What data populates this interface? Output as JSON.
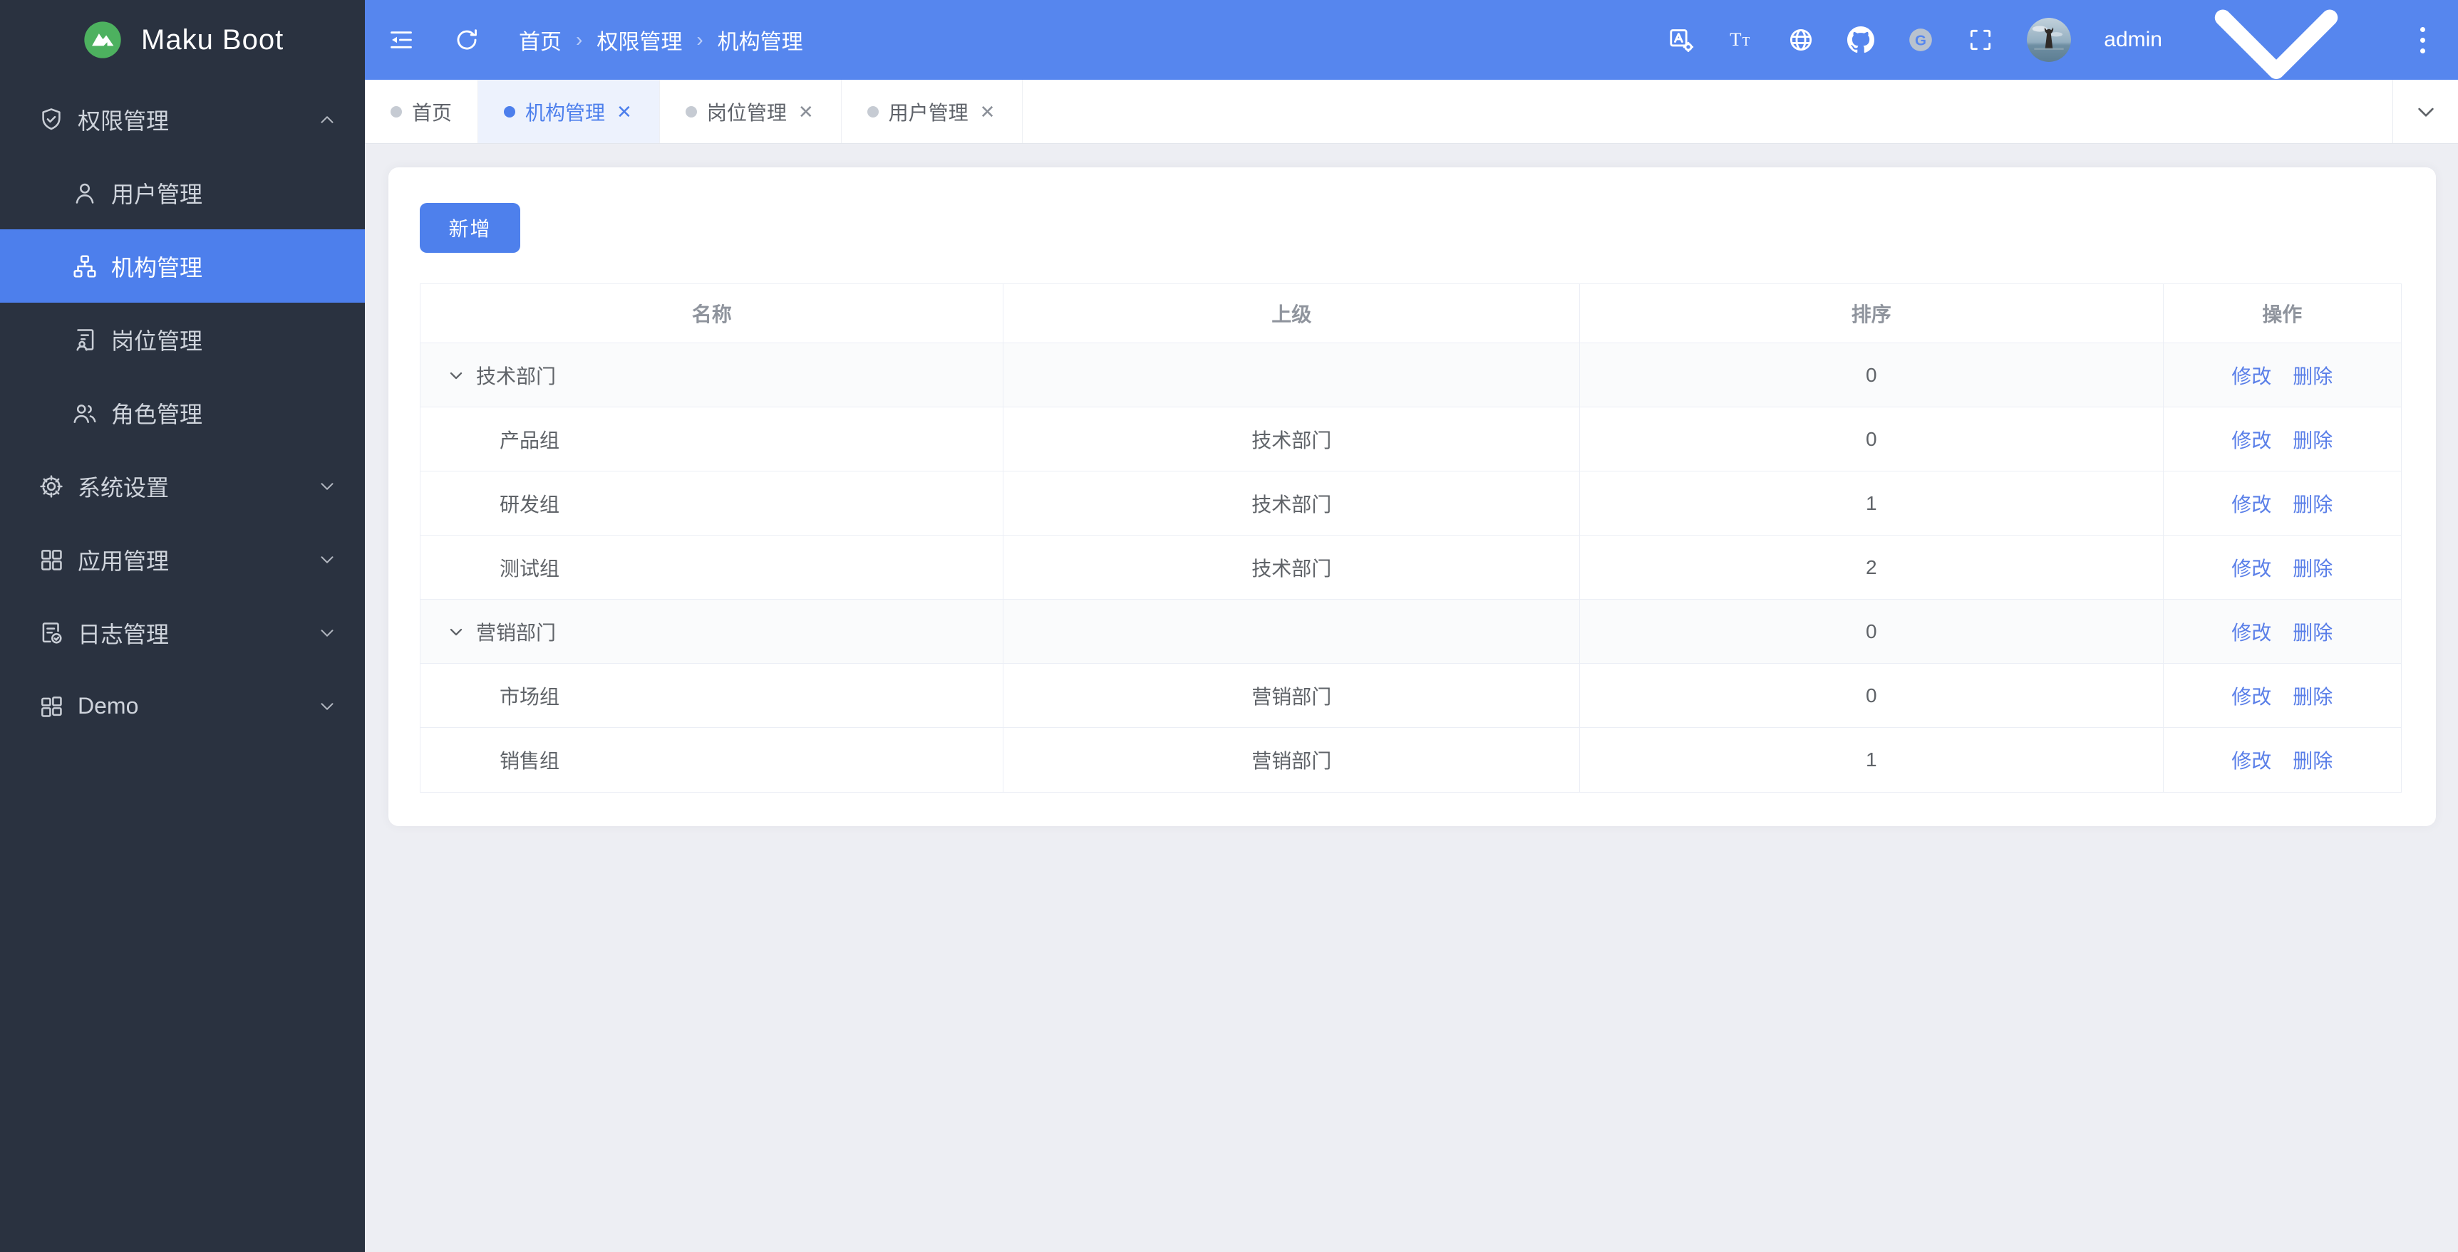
{
  "app": {
    "title": "Maku Boot"
  },
  "theme": {
    "header_blue": "#5686ee",
    "primary_blue": "#4d7fec",
    "link_blue": "#5a7fe8",
    "sidebar_bg": "#2a3240",
    "content_bg": "#edeef3",
    "logo_green": "#4db15f"
  },
  "header": {
    "breadcrumb": [
      "首页",
      "权限管理",
      "机构管理"
    ],
    "username": "admin",
    "icons": [
      "fold",
      "refresh",
      "translate",
      "font-size",
      "globe",
      "github",
      "gitee",
      "fullscreen",
      "more"
    ]
  },
  "sidebar": {
    "items": [
      {
        "label": "权限管理",
        "level": "top",
        "state": "expanded",
        "icon": "shield-check"
      },
      {
        "label": "用户管理",
        "level": "sub",
        "icon": "user"
      },
      {
        "label": "机构管理",
        "level": "sub",
        "active": true,
        "icon": "org-chart"
      },
      {
        "label": "岗位管理",
        "level": "sub",
        "icon": "post-doc"
      },
      {
        "label": "角色管理",
        "level": "sub",
        "icon": "roles"
      },
      {
        "label": "系统设置",
        "level": "top",
        "state": "collapsed",
        "icon": "gear"
      },
      {
        "label": "应用管理",
        "level": "top",
        "state": "collapsed",
        "icon": "apps-grid"
      },
      {
        "label": "日志管理",
        "level": "top",
        "state": "collapsed",
        "icon": "log-doc"
      },
      {
        "label": "Demo",
        "level": "top",
        "state": "collapsed",
        "icon": "demo-grid"
      }
    ]
  },
  "tabs": {
    "items": [
      {
        "label": "首页",
        "active": false,
        "closable": false
      },
      {
        "label": "机构管理",
        "active": true,
        "closable": true
      },
      {
        "label": "岗位管理",
        "active": false,
        "closable": true
      },
      {
        "label": "用户管理",
        "active": false,
        "closable": true
      }
    ],
    "close_glyph": "✕"
  },
  "toolbar": {
    "add_label": "新增"
  },
  "table": {
    "columns": [
      "名称",
      "上级",
      "排序",
      "操作"
    ],
    "edit_label": "修改",
    "delete_label": "删除",
    "rows": [
      {
        "name": "技术部门",
        "parent": "",
        "sort": "0",
        "type": "parent",
        "expanded": true
      },
      {
        "name": "产品组",
        "parent": "技术部门",
        "sort": "0",
        "type": "child"
      },
      {
        "name": "研发组",
        "parent": "技术部门",
        "sort": "1",
        "type": "child"
      },
      {
        "name": "测试组",
        "parent": "技术部门",
        "sort": "2",
        "type": "child"
      },
      {
        "name": "营销部门",
        "parent": "",
        "sort": "0",
        "type": "parent",
        "expanded": true
      },
      {
        "name": "市场组",
        "parent": "营销部门",
        "sort": "0",
        "type": "child"
      },
      {
        "name": "销售组",
        "parent": "营销部门",
        "sort": "1",
        "type": "child"
      }
    ]
  }
}
